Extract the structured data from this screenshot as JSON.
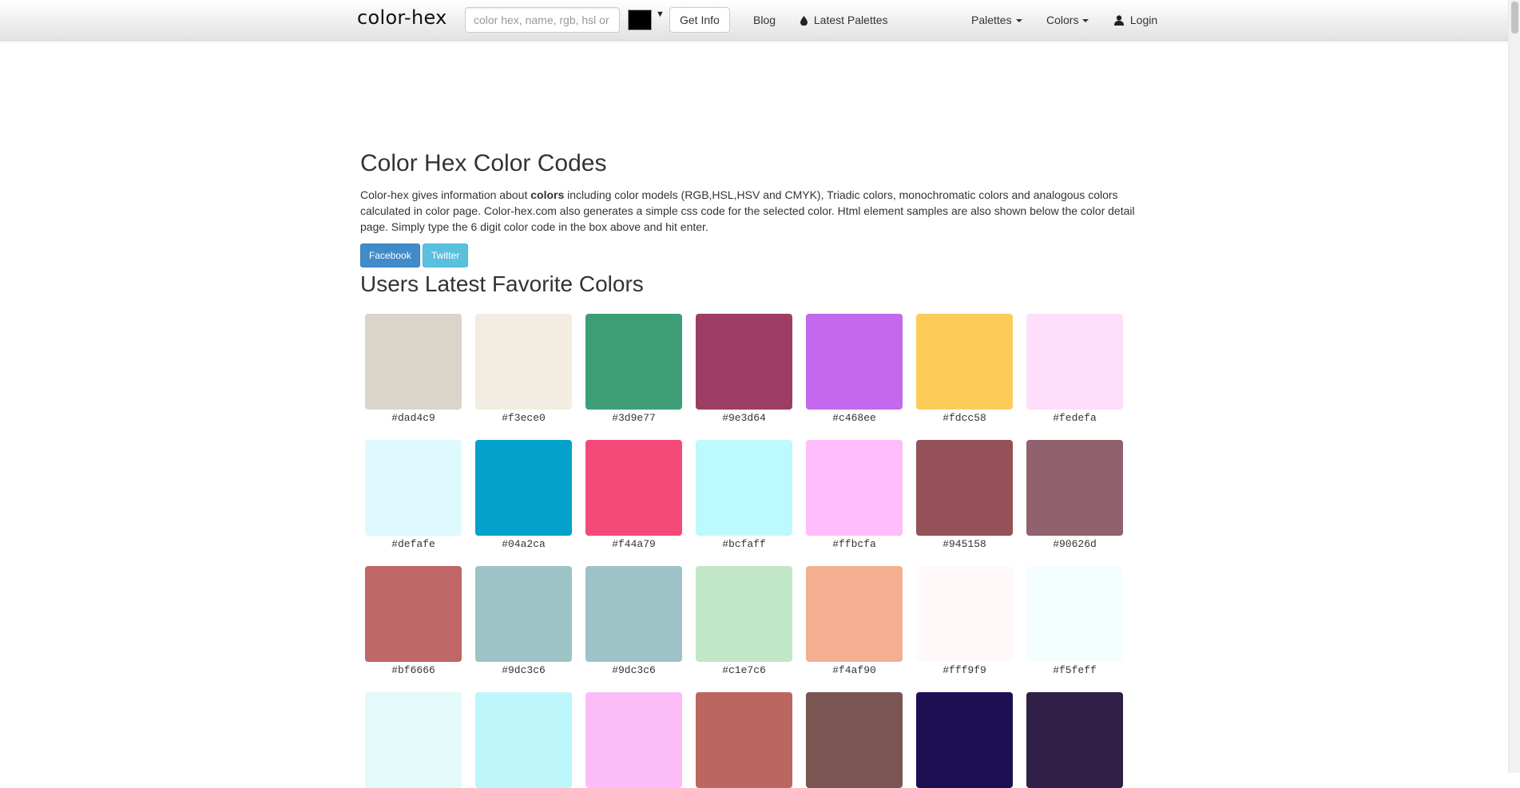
{
  "navbar": {
    "brand": "color-hex",
    "search_placeholder": "color hex, name, rgb, hsl or",
    "picker_color": "#000000",
    "picker_caret": "▼",
    "get_info_label": "Get Info",
    "blog_label": "Blog",
    "latest_palettes_label": "Latest Palettes",
    "palettes_label": "Palettes",
    "colors_label": "Colors",
    "login_label": "Login"
  },
  "main": {
    "title": "Color Hex Color Codes",
    "intro_before": "Color-hex gives information about ",
    "intro_bold": "colors",
    "intro_after": " including color models (RGB,HSL,HSV and CMYK), Triadic colors, monochromatic colors and analogous colors calculated in color page. Color-hex.com also generates a simple css code for the selected color. Html element samples are also shown below the color detail page. Simply type the 6 digit color code in the box above and hit enter.",
    "facebook_label": "Facebook",
    "twitter_label": "Twitter",
    "favorites_title": "Users Latest Favorite Colors"
  },
  "favorite_colors": [
    {
      "hex": "#dad4c9",
      "label": "#dad4c9"
    },
    {
      "hex": "#f3ece0",
      "label": "#f3ece0"
    },
    {
      "hex": "#3d9e77",
      "label": "#3d9e77"
    },
    {
      "hex": "#9e3d64",
      "label": "#9e3d64"
    },
    {
      "hex": "#c468ee",
      "label": "#c468ee"
    },
    {
      "hex": "#fdcc58",
      "label": "#fdcc58"
    },
    {
      "hex": "#fedefa",
      "label": "#fedefa"
    },
    {
      "hex": "#defafe",
      "label": "#defafe"
    },
    {
      "hex": "#04a2ca",
      "label": "#04a2ca"
    },
    {
      "hex": "#f44a79",
      "label": "#f44a79"
    },
    {
      "hex": "#bcfaff",
      "label": "#bcfaff"
    },
    {
      "hex": "#ffbcfa",
      "label": "#ffbcfa"
    },
    {
      "hex": "#945158",
      "label": "#945158"
    },
    {
      "hex": "#90626d",
      "label": "#90626d"
    },
    {
      "hex": "#bf6666",
      "label": "#bf6666"
    },
    {
      "hex": "#9dc3c6",
      "label": "#9dc3c6"
    },
    {
      "hex": "#9dc3c6",
      "label": "#9dc3c6"
    },
    {
      "hex": "#c1e7c6",
      "label": "#c1e7c6"
    },
    {
      "hex": "#f4af90",
      "label": "#f4af90"
    },
    {
      "hex": "#fff9f9",
      "label": "#fff9f9"
    },
    {
      "hex": "#f5feff",
      "label": "#f5feff"
    },
    {
      "hex": "#e4f9fa",
      "label": ""
    },
    {
      "hex": "#bcf6fb",
      "label": ""
    },
    {
      "hex": "#fbbcf8",
      "label": ""
    },
    {
      "hex": "#bc6661",
      "label": ""
    },
    {
      "hex": "#7a5552",
      "label": ""
    },
    {
      "hex": "#1e0e52",
      "label": ""
    },
    {
      "hex": "#301f46",
      "label": ""
    }
  ]
}
